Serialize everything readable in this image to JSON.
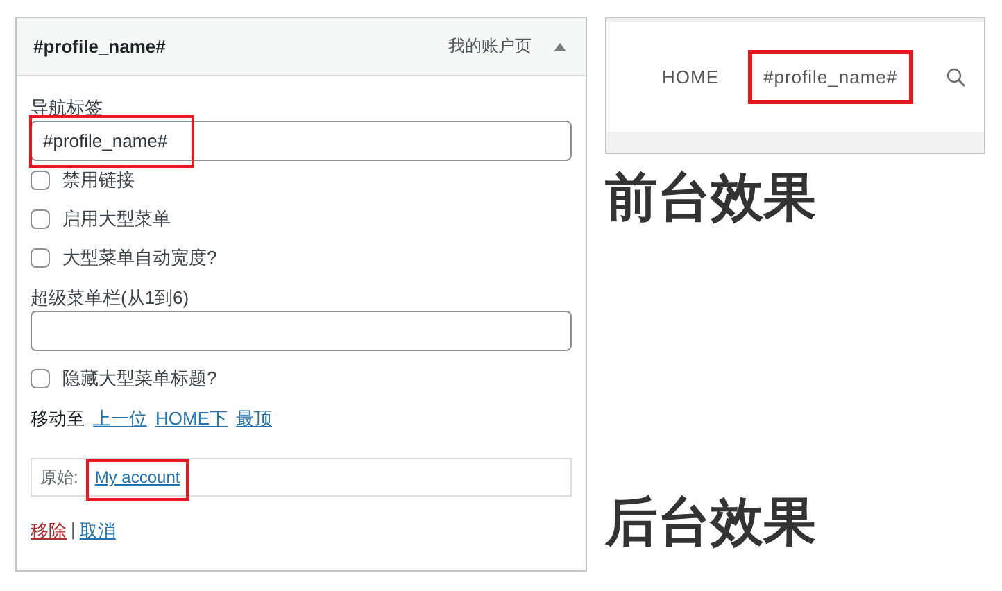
{
  "panel": {
    "title": "#profile_name#",
    "item_type": "我的账户页",
    "expanded": true,
    "nav_label": {
      "label": "导航标签",
      "value": "#profile_name#",
      "highlighted": true
    },
    "options": [
      {
        "label": "禁用链接",
        "checked": false
      },
      {
        "label": "启用大型菜单",
        "checked": false
      },
      {
        "label": "大型菜单自动宽度?",
        "checked": false
      }
    ],
    "columns_field": {
      "label": "超级菜单栏(从1到6)"
    },
    "hide_title": {
      "label": "隐藏大型菜单标题?",
      "checked": false
    },
    "move": {
      "label": "移动至",
      "links": [
        "上一位",
        "HOME下",
        "最顶"
      ]
    },
    "original": {
      "label": "原始:",
      "link": "My account",
      "highlighted": true
    },
    "actions": {
      "remove": "移除",
      "separator": "|",
      "cancel": "取消"
    }
  },
  "preview": {
    "nav": [
      {
        "label": "HOME",
        "highlighted": false
      },
      {
        "label": "#profile_name#",
        "highlighted": true
      }
    ]
  },
  "captions": {
    "front": "前台效果",
    "back": "后台效果"
  }
}
